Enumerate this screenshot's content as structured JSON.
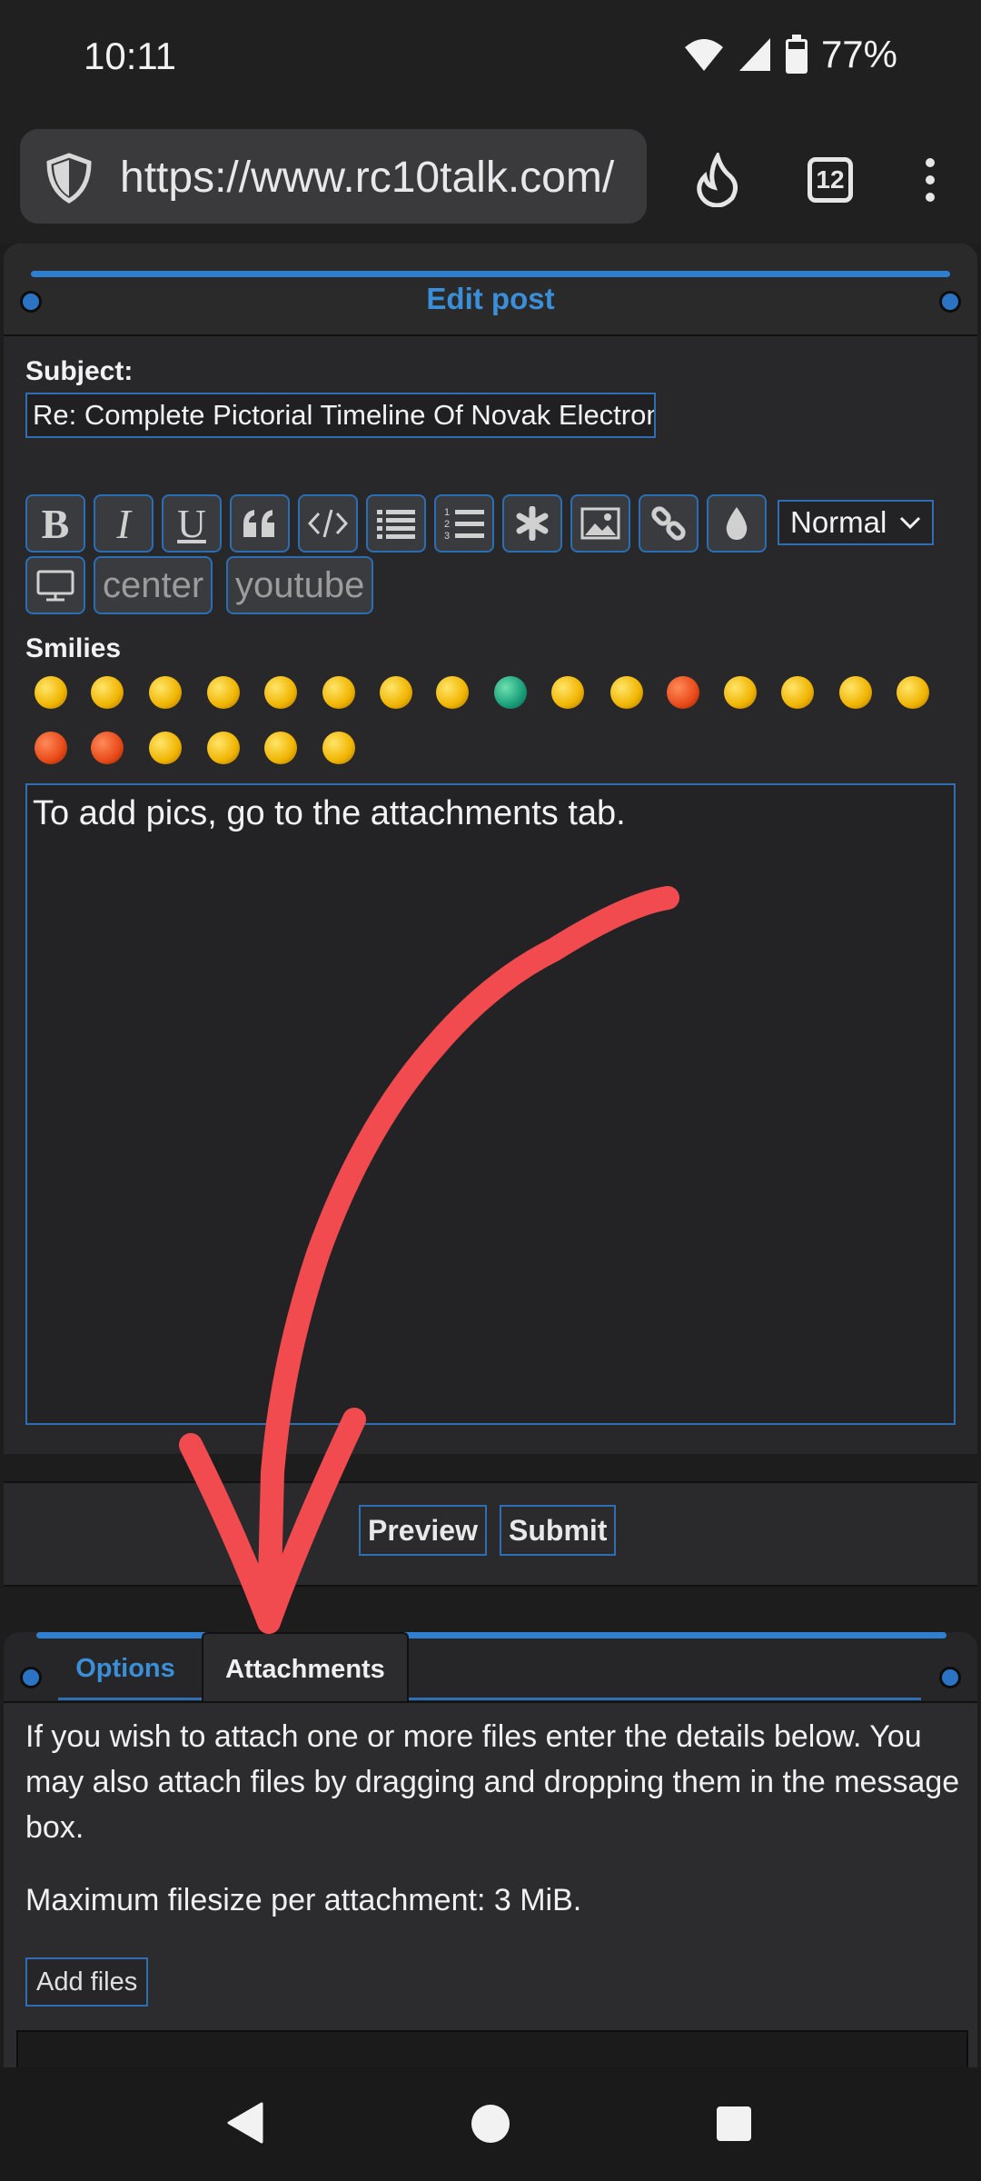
{
  "status": {
    "time": "10:11",
    "battery": "77%"
  },
  "browser": {
    "url": "https://www.rc10talk.com/",
    "tab_count": "12"
  },
  "panel": {
    "title": "Edit post",
    "subject_label": "Subject:",
    "subject_value": "Re: Complete Pictorial Timeline Of Novak Electronic"
  },
  "toolbar": {
    "center_label": "center",
    "youtube_label": "youtube",
    "size_value": "Normal"
  },
  "smilies_label": "Smilies",
  "message": {
    "text": "To add pics, go to the attachments tab."
  },
  "buttons": {
    "preview": "Preview",
    "submit": "Submit"
  },
  "tabs": {
    "options": "Options",
    "attachments": "Attachments"
  },
  "attachments": {
    "intro": "If you wish to attach one or more files enter the details below. You may also attach files by dragging and dropping them in the message box.",
    "max_size": "Maximum filesize per attachment: 3 MiB.",
    "add_files": "Add files"
  }
}
